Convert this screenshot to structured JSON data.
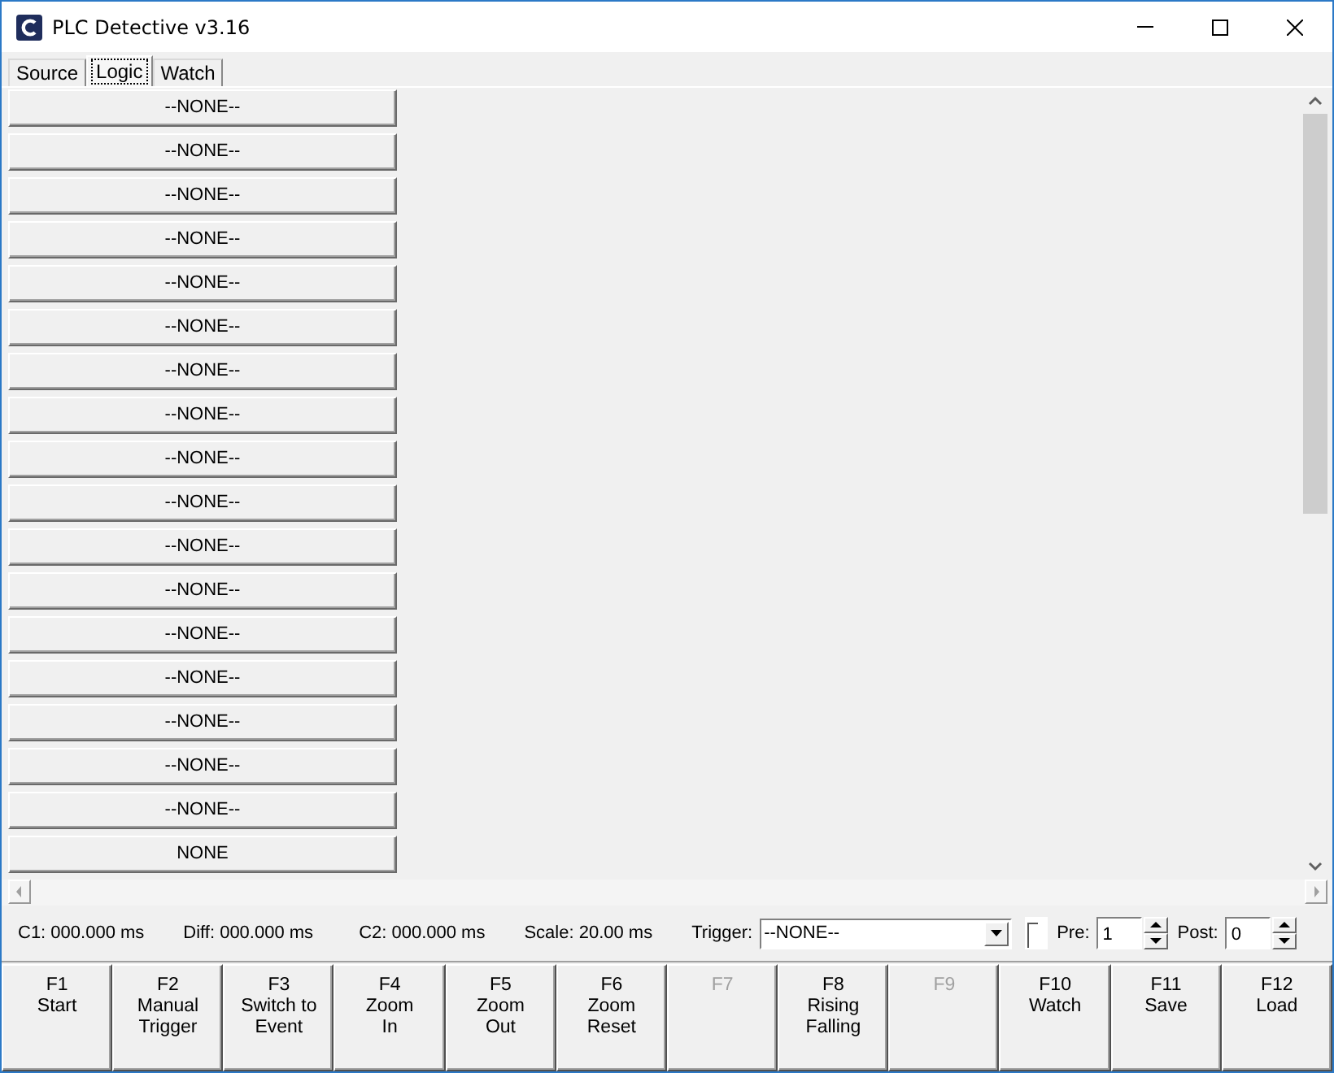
{
  "window": {
    "title": "PLC Detective v3.16"
  },
  "tabs": [
    {
      "label": "Source",
      "selected": false
    },
    {
      "label": "Logic",
      "selected": true
    },
    {
      "label": "Watch",
      "selected": false
    }
  ],
  "signals": [
    {
      "label": "--NONE--"
    },
    {
      "label": "--NONE--"
    },
    {
      "label": "--NONE--"
    },
    {
      "label": "--NONE--"
    },
    {
      "label": "--NONE--"
    },
    {
      "label": "--NONE--"
    },
    {
      "label": "--NONE--"
    },
    {
      "label": "--NONE--"
    },
    {
      "label": "--NONE--"
    },
    {
      "label": "--NONE--"
    },
    {
      "label": "--NONE--"
    },
    {
      "label": "--NONE--"
    },
    {
      "label": "--NONE--"
    },
    {
      "label": "--NONE--"
    },
    {
      "label": "--NONE--"
    },
    {
      "label": "--NONE--"
    },
    {
      "label": "--NONE--"
    },
    {
      "label": "NONE"
    }
  ],
  "status": {
    "readouts": [
      "C1: 000.000 ms",
      "Diff: 000.000 ms",
      "C2: 000.000 ms",
      "Scale: 20.00 ms"
    ],
    "trigger_label": "Trigger:",
    "trigger_value": "--NONE--",
    "pre_label": "Pre:",
    "pre_value": "1",
    "post_label": "Post:",
    "post_value": "0"
  },
  "function_keys": [
    {
      "key": "F1",
      "lines": [
        "Start"
      ],
      "disabled": false
    },
    {
      "key": "F2",
      "lines": [
        "Manual",
        "Trigger"
      ],
      "disabled": false
    },
    {
      "key": "F3",
      "lines": [
        "Switch to",
        "Event"
      ],
      "disabled": false
    },
    {
      "key": "F4",
      "lines": [
        "Zoom",
        "In"
      ],
      "disabled": false
    },
    {
      "key": "F5",
      "lines": [
        "Zoom",
        "Out"
      ],
      "disabled": false
    },
    {
      "key": "F6",
      "lines": [
        "Zoom",
        "Reset"
      ],
      "disabled": false
    },
    {
      "key": "F7",
      "disabled": true
    },
    {
      "key": "F8",
      "lines": [
        "Rising",
        "Falling"
      ],
      "disabled": false
    },
    {
      "key": "F9",
      "disabled": true
    },
    {
      "key": "F10",
      "lines": [
        "Watch"
      ],
      "disabled": false
    },
    {
      "key": "F11",
      "lines": [
        "Save"
      ],
      "disabled": false
    },
    {
      "key": "F12",
      "lines": [
        "Load"
      ],
      "disabled": false
    }
  ]
}
